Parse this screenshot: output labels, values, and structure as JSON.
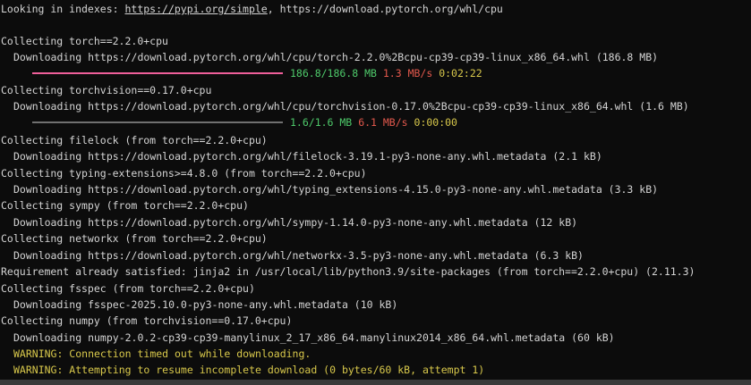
{
  "terminal": {
    "looking_prefix": "Looking in indexes: ",
    "index_url_1": "https://pypi.org/simple",
    "index_sep": ", ",
    "index_url_2": "https://download.pytorch.org/whl/cpu",
    "lines": {
      "collect_torch": "Collecting torch==2.2.0+cpu",
      "dl_torch": "Downloading https://download.pytorch.org/whl/cpu/torch-2.2.0%2Bcpu-cp39-cp39-linux_x86_64.whl (186.8 MB)",
      "collect_torchvision": "Collecting torchvision==0.17.0+cpu",
      "dl_torchvision": "Downloading https://download.pytorch.org/whl/cpu/torchvision-0.17.0%2Bcpu-cp39-cp39-linux_x86_64.whl (1.6 MB)",
      "collect_filelock": "Collecting filelock (from torch==2.2.0+cpu)",
      "dl_filelock": "Downloading https://download.pytorch.org/whl/filelock-3.19.1-py3-none-any.whl.metadata (2.1 kB)",
      "collect_typing": "Collecting typing-extensions>=4.8.0 (from torch==2.2.0+cpu)",
      "dl_typing": "Downloading https://download.pytorch.org/whl/typing_extensions-4.15.0-py3-none-any.whl.metadata (3.3 kB)",
      "collect_sympy": "Collecting sympy (from torch==2.2.0+cpu)",
      "dl_sympy": "Downloading https://download.pytorch.org/whl/sympy-1.14.0-py3-none-any.whl.metadata (12 kB)",
      "collect_networkx": "Collecting networkx (from torch==2.2.0+cpu)",
      "dl_networkx": "Downloading https://download.pytorch.org/whl/networkx-3.5-py3-none-any.whl.metadata (6.3 kB)",
      "req_jinja2": "Requirement already satisfied: jinja2 in /usr/local/lib/python3.9/site-packages (from torch==2.2.0+cpu) (2.11.3)",
      "collect_fsspec": "Collecting fsspec (from torch==2.2.0+cpu)",
      "dl_fsspec": "Downloading fsspec-2025.10.0-py3-none-any.whl.metadata (10 kB)",
      "collect_numpy": "Collecting numpy (from torchvision==0.17.0+cpu)",
      "dl_numpy": "Downloading numpy-2.0.2-cp39-cp39-manylinux_2_17_x86_64.manylinux2014_x86_64.whl.metadata (60 kB)",
      "warn_timeout": "WARNING: Connection timed out while downloading.",
      "warn_resume": "WARNING: Attempting to resume incomplete download (0 bytes/60 kB, attempt 1)"
    },
    "progress_torch": {
      "size": "186.8/186.8 MB",
      "speed": "1.3 MB/s",
      "eta": "0:02:22",
      "fraction": 1.0
    },
    "progress_torchvision": {
      "size": "1.6/1.6 MB",
      "speed": "6.1 MB/s",
      "eta": "0:00:00",
      "fraction": 1.0
    },
    "colors": {
      "background": "#0c0c0c",
      "text": "#d4d4d4",
      "bar_torch": "#f05f9a",
      "bar_torchvision": "#707070",
      "green": "#4ec96a",
      "red": "#e2584c",
      "yellow": "#d8c84b"
    }
  }
}
